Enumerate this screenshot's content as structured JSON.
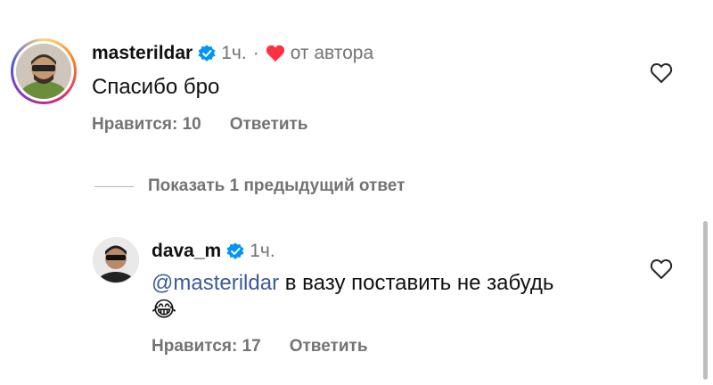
{
  "comments": [
    {
      "username": "masterildar",
      "time": "1ч.",
      "author_like": "от автора",
      "text": "Спасибо бро",
      "likes_label": "Нравится: 10",
      "reply_label": "Ответить"
    },
    {
      "username": "dava_m",
      "time": "1ч.",
      "mention": "@masterildar",
      "text": " в вазу поставить не забудь",
      "emoji": "😂",
      "likes_label": "Нравится: 17",
      "reply_label": "Ответить"
    }
  ],
  "replies_toggle": "Показать 1 предыдущий ответ",
  "colors": {
    "verified": "#0095f6",
    "heart": "#ff3040",
    "secondary_text": "#737373",
    "mention": "#3d5a98"
  },
  "icons": [
    "verified-badge-icon",
    "heart-icon",
    "like-heart-outline-icon",
    "avatar"
  ]
}
